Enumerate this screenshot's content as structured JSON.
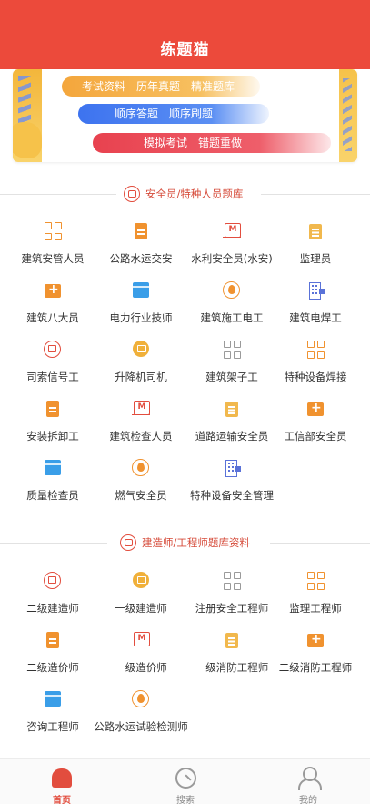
{
  "header": {
    "title": "练题猫"
  },
  "banner": {
    "row1": [
      "考试资料",
      "历年真题",
      "精准题库"
    ],
    "row2": [
      "顺序答题",
      "顺序刷题"
    ],
    "row3": [
      "模拟考试",
      "错题重做"
    ]
  },
  "sections": [
    {
      "title": "安全员/特种人员题库",
      "items": [
        {
          "label": "建筑安管人员",
          "icon": "grid-icon",
          "color": "#f0922f"
        },
        {
          "label": "公路水运交安",
          "icon": "document-icon",
          "color": "#f0922f"
        },
        {
          "label": "水利安全员(水安)",
          "icon": "meter-icon",
          "color": "#e24d3e"
        },
        {
          "label": "监理员",
          "icon": "clipboard-icon",
          "color": "#f0b03a"
        },
        {
          "label": "建筑八大员",
          "icon": "medkit-icon",
          "color": "#f0922f"
        },
        {
          "label": "电力行业技师",
          "icon": "folder-icon",
          "color": "#3a9ee8"
        },
        {
          "label": "建筑施工电工",
          "icon": "fire-icon",
          "color": "#f0922f"
        },
        {
          "label": "建筑电焊工",
          "icon": "building-icon",
          "color": "#5a72d8"
        },
        {
          "label": "司索信号工",
          "icon": "signal-icon",
          "color": "#e24d3e"
        },
        {
          "label": "升降机司机",
          "icon": "elevator-icon",
          "color": "#f0b03a"
        },
        {
          "label": "建筑架子工",
          "icon": "grid-icon",
          "color": "#9a9a9a"
        },
        {
          "label": "特种设备焊接",
          "icon": "grid-icon",
          "color": "#f0922f"
        },
        {
          "label": "安装拆卸工",
          "icon": "document-icon",
          "color": "#f0922f"
        },
        {
          "label": "建筑检查人员",
          "icon": "meter-icon",
          "color": "#e24d3e"
        },
        {
          "label": "道路运输安全员",
          "icon": "clipboard-icon",
          "color": "#f0b03a"
        },
        {
          "label": "工信部安全员",
          "icon": "medkit-icon",
          "color": "#f0922f"
        },
        {
          "label": "质量检查员",
          "icon": "folder-icon",
          "color": "#3a9ee8"
        },
        {
          "label": "燃气安全员",
          "icon": "fire-icon",
          "color": "#f0922f"
        },
        {
          "label": "特种设备安全管理",
          "icon": "building-icon",
          "color": "#5a72d8"
        }
      ]
    },
    {
      "title": "建造师/工程师题库资料",
      "items": [
        {
          "label": "二级建造师",
          "icon": "signal-icon",
          "color": "#e24d3e"
        },
        {
          "label": "一级建造师",
          "icon": "elevator-icon",
          "color": "#f0b03a"
        },
        {
          "label": "注册安全工程师",
          "icon": "grid-icon",
          "color": "#9a9a9a"
        },
        {
          "label": "监理工程师",
          "icon": "grid-icon",
          "color": "#f0922f"
        },
        {
          "label": "二级造价师",
          "icon": "document-icon",
          "color": "#f0922f"
        },
        {
          "label": "一级造价师",
          "icon": "meter-icon",
          "color": "#e24d3e"
        },
        {
          "label": "一级消防工程师",
          "icon": "clipboard-icon",
          "color": "#f0b03a"
        },
        {
          "label": "二级消防工程师",
          "icon": "medkit-icon",
          "color": "#f0922f"
        },
        {
          "label": "咨询工程师",
          "icon": "folder-icon",
          "color": "#3a9ee8"
        },
        {
          "label": "公路水运试验检测师",
          "icon": "fire-icon",
          "color": "#f0922f"
        }
      ]
    }
  ],
  "tabbar": {
    "home": "首页",
    "search": "搜索",
    "mine": "我的"
  },
  "colors": {
    "brand": "#ec4a3b",
    "section_accent": "#d64b3a"
  }
}
